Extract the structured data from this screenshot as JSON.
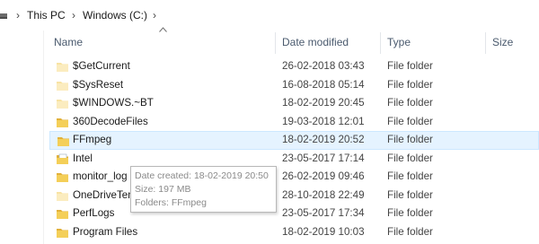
{
  "breadcrumb": {
    "items": [
      "This PC",
      "Windows (C:)"
    ],
    "separator": "›"
  },
  "columns": {
    "name": "Name",
    "date_modified": "Date modified",
    "type": "Type",
    "size": "Size"
  },
  "rows": [
    {
      "name": "$GetCurrent",
      "date": "26-02-2018 03:43",
      "type": "File folder",
      "icon": "folder-icon-faded"
    },
    {
      "name": "$SysReset",
      "date": "16-08-2018 05:14",
      "type": "File folder",
      "icon": "folder-icon-faded"
    },
    {
      "name": "$WINDOWS.~BT",
      "date": "18-02-2019 20:45",
      "type": "File folder",
      "icon": "folder-icon-faded"
    },
    {
      "name": "360DecodeFiles",
      "date": "19-03-2018 12:01",
      "type": "File folder",
      "icon": "folder-icon"
    },
    {
      "name": "FFmpeg",
      "date": "18-02-2019 20:52",
      "type": "File folder",
      "icon": "folder-icon",
      "selected": true
    },
    {
      "name": "Intel",
      "date": "23-05-2017 17:14",
      "type": "File folder",
      "icon": "folder-icon-document"
    },
    {
      "name": "monitor_log",
      "date": "26-02-2019 09:46",
      "type": "File folder",
      "icon": "folder-icon"
    },
    {
      "name": "OneDriveTemp",
      "date": "28-10-2018 22:49",
      "type": "File folder",
      "icon": "folder-icon-faded"
    },
    {
      "name": "PerfLogs",
      "date": "23-05-2017 17:34",
      "type": "File folder",
      "icon": "folder-icon"
    },
    {
      "name": "Program Files",
      "date": "18-02-2019 10:03",
      "type": "File folder",
      "icon": "folder-icon"
    }
  ],
  "tooltip": {
    "date_created": "Date created: 18-02-2019 20:50",
    "size": "Size: 197 MB",
    "folders": "Folders: FFmpeg"
  },
  "colors": {
    "folder": "#f4cf58",
    "folder_dark": "#e2b13a",
    "selection_bg": "#e5f3ff",
    "selection_border": "#cce8ff",
    "header_text": "#4a5a6e"
  }
}
